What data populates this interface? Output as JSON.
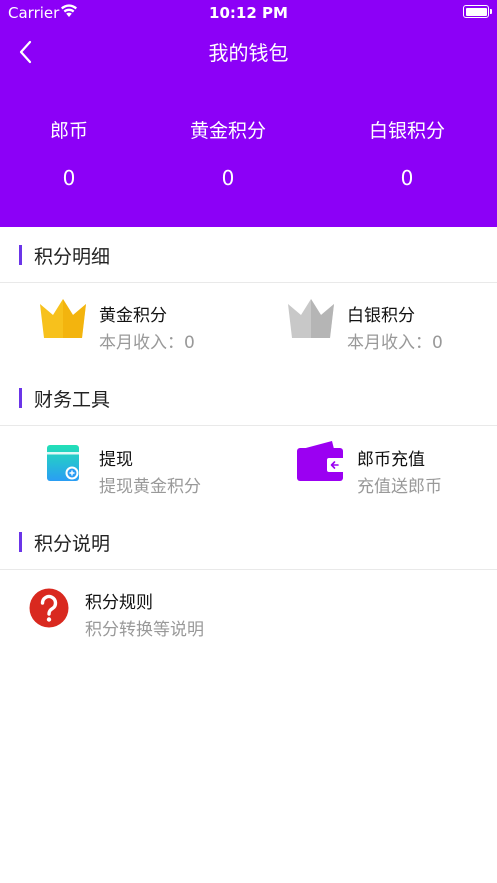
{
  "status_bar": {
    "carrier": "Carrier",
    "time": "10:12 PM"
  },
  "nav": {
    "title": "我的钱包"
  },
  "balances": [
    {
      "label": "郎币",
      "value": "0"
    },
    {
      "label": "黄金积分",
      "value": "0"
    },
    {
      "label": "白银积分",
      "value": "0"
    }
  ],
  "sections": {
    "points_detail": {
      "title": "积分明细",
      "items": [
        {
          "title": "黄金积分",
          "subtitle": "本月收入：0",
          "icon": "gold-crown-icon"
        },
        {
          "title": "白银积分",
          "subtitle": "本月收入：0",
          "icon": "silver-crown-icon"
        }
      ]
    },
    "finance_tools": {
      "title": "财务工具",
      "items": [
        {
          "title": "提现",
          "subtitle": "提现黄金积分",
          "icon": "withdraw-icon"
        },
        {
          "title": "郎币充值",
          "subtitle": "充值送郎币",
          "icon": "wallet-icon"
        }
      ]
    },
    "points_info": {
      "title": "积分说明",
      "items": [
        {
          "title": "积分规则",
          "subtitle": "积分转换等说明",
          "icon": "question-mark-icon"
        }
      ]
    }
  },
  "colors": {
    "header_bg": "#8c00f7",
    "section_accent": "#6b35e8",
    "gold": "#f7c11c",
    "silver": "#bdbdbd",
    "wallet": "#9b00f2",
    "withdraw_top": "#22e0b6",
    "withdraw_bottom": "#2a9df4",
    "question_red": "#d9291f"
  }
}
